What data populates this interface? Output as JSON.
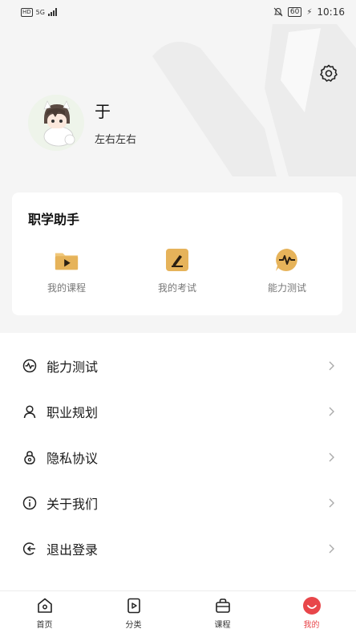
{
  "status_bar": {
    "network": "5G",
    "hd": "HD",
    "battery": "60",
    "time": "10:16"
  },
  "profile": {
    "name": "于",
    "subtitle": "左右左右"
  },
  "assistant": {
    "title": "职学助手",
    "tools": [
      {
        "label": "我的课程",
        "icon": "play-folder-icon"
      },
      {
        "label": "我的考试",
        "icon": "pencil-note-icon"
      },
      {
        "label": "能力测试",
        "icon": "pulse-chat-icon"
      }
    ]
  },
  "menu": {
    "items": [
      {
        "label": "能力测试",
        "icon": "pulse-icon"
      },
      {
        "label": "职业规划",
        "icon": "person-icon"
      },
      {
        "label": "隐私协议",
        "icon": "lock-icon"
      },
      {
        "label": "关于我们",
        "icon": "info-icon"
      },
      {
        "label": "退出登录",
        "icon": "logout-icon"
      }
    ]
  },
  "tabbar": {
    "tabs": [
      {
        "label": "首页",
        "icon": "home-icon"
      },
      {
        "label": "分类",
        "icon": "category-icon"
      },
      {
        "label": "课程",
        "icon": "bag-icon"
      },
      {
        "label": "我的",
        "icon": "profile-icon"
      }
    ],
    "active_index": 3
  },
  "colors": {
    "accent": "#e8464a",
    "icon_gold": "#e6b35a",
    "background": "#f5f5f5"
  }
}
